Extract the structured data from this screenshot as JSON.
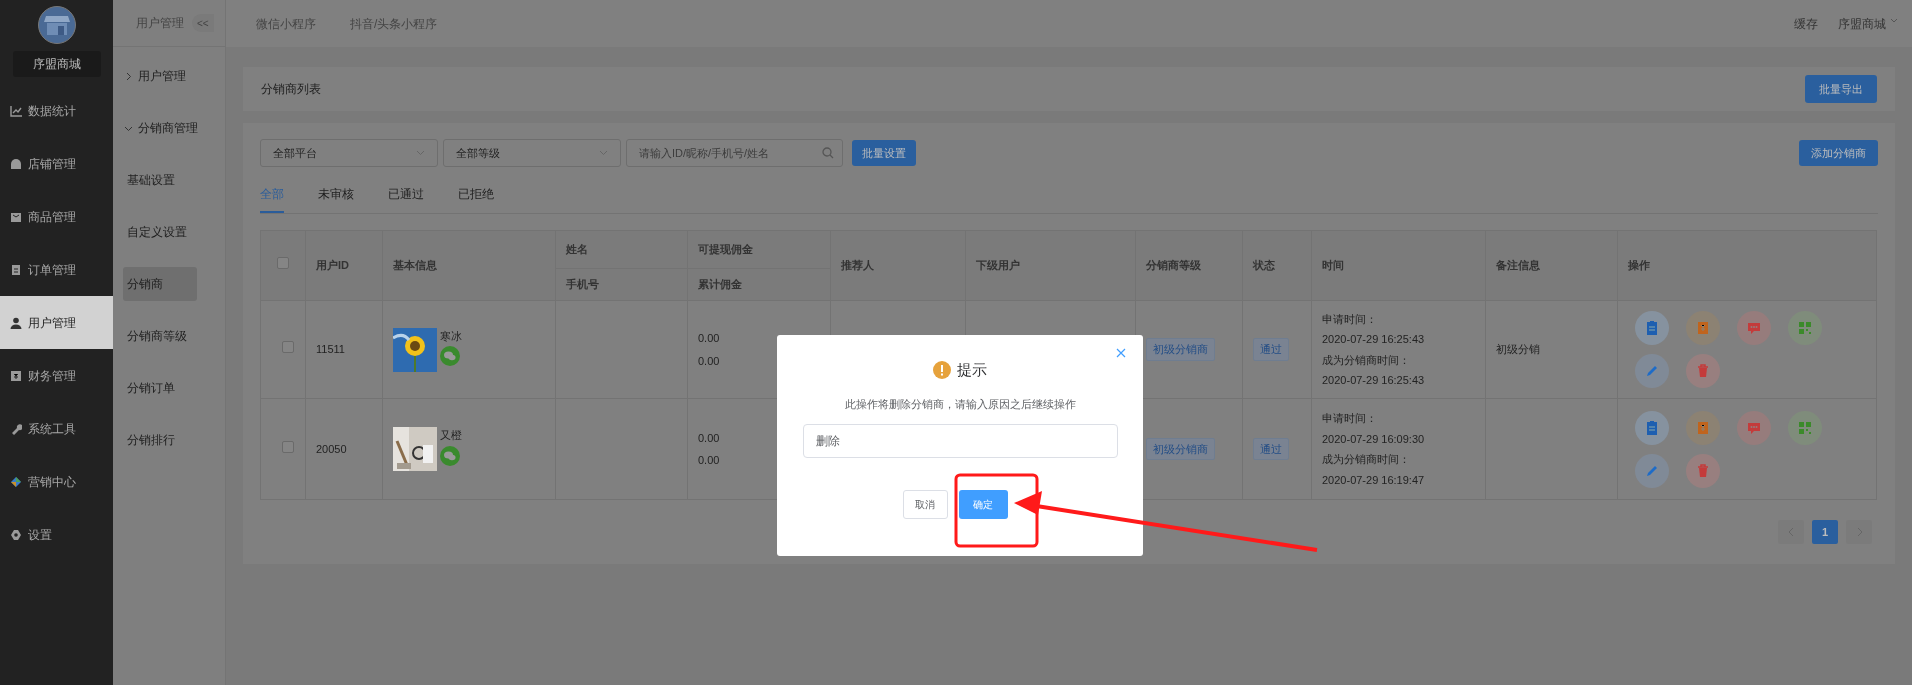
{
  "sidebar": {
    "shop_name": "序盟商城",
    "items": [
      {
        "label": "数据统计",
        "selected": false
      },
      {
        "label": "店铺管理",
        "selected": false
      },
      {
        "label": "商品管理",
        "selected": false
      },
      {
        "label": "订单管理",
        "selected": false
      },
      {
        "label": "用户管理",
        "selected": true
      },
      {
        "label": "财务管理",
        "selected": false
      },
      {
        "label": "系统工具",
        "selected": false
      },
      {
        "label": "营销中心",
        "selected": false
      },
      {
        "label": "设置",
        "selected": false
      }
    ]
  },
  "subnav": {
    "title": "用户管理",
    "collapse": "<<",
    "groups": [
      {
        "label": "用户管理",
        "expanded": false
      },
      {
        "label": "分销商管理",
        "expanded": true,
        "children": [
          {
            "label": "基础设置",
            "selected": false
          },
          {
            "label": "自定义设置",
            "selected": false
          },
          {
            "label": "分销商",
            "selected": true
          },
          {
            "label": "分销商等级",
            "selected": false
          },
          {
            "label": "分销订单",
            "selected": false
          },
          {
            "label": "分销排行",
            "selected": false
          }
        ]
      }
    ]
  },
  "topbar": {
    "tabs": [
      "微信小程序",
      "抖音/头条小程序"
    ],
    "cache": "缓存",
    "user": "序盟商城"
  },
  "header": {
    "title": "分销商列表",
    "export_button": "批量导出"
  },
  "filters": {
    "platform": "全部平台",
    "level": "全部等级",
    "search_placeholder": "请输入ID/昵称/手机号/姓名",
    "batch_button": "批量设置",
    "add_button": "添加分销商"
  },
  "tabs": [
    {
      "label": "全部",
      "selected": true
    },
    {
      "label": "未审核",
      "selected": false
    },
    {
      "label": "已通过",
      "selected": false
    },
    {
      "label": "已拒绝",
      "selected": false
    }
  ],
  "table": {
    "all_checked": false,
    "columns": [
      {
        "label": "用户ID"
      },
      {
        "label": "基本信息"
      },
      {
        "label": "姓名",
        "sub_label": "手机号"
      },
      {
        "label": "可提现佣金",
        "sub_label": "累计佣金"
      },
      {
        "label": "推荐人"
      },
      {
        "label": "下级用户"
      },
      {
        "label": "分销商等级"
      },
      {
        "label": "状态"
      },
      {
        "label": "时间"
      },
      {
        "label": "备注信息"
      },
      {
        "label": "操作"
      }
    ],
    "rows": [
      {
        "checked": false,
        "id": "11511",
        "nickname": "寒冰",
        "commission": "0.00",
        "total_commission": "0.00",
        "level": "初级分销商",
        "status": "通过",
        "apply_label": "申请时间：",
        "apply_time": "2020-07-29 16:25:43",
        "join_label": "成为分销商时间：",
        "join_time": "2020-07-29 16:25:43",
        "note": "初级分销"
      },
      {
        "checked": false,
        "id": "20050",
        "nickname": "又橙",
        "commission": "0.00",
        "total_commission": "0.00",
        "level": "初级分销商",
        "status": "通过",
        "apply_label": "申请时间：",
        "apply_time": "2020-07-29 16:09:30",
        "join_label": "成为分销商时间：",
        "join_time": "2020-07-29 16:19:47"
      }
    ]
  },
  "pagination": {
    "pages": [
      {
        "label": "1",
        "selected": true
      }
    ]
  },
  "dialog": {
    "title": "提示",
    "message": "此操作将删除分销商，请输入原因之后继续操作",
    "value": "删除",
    "cancel": "取消",
    "confirm": "确定"
  }
}
